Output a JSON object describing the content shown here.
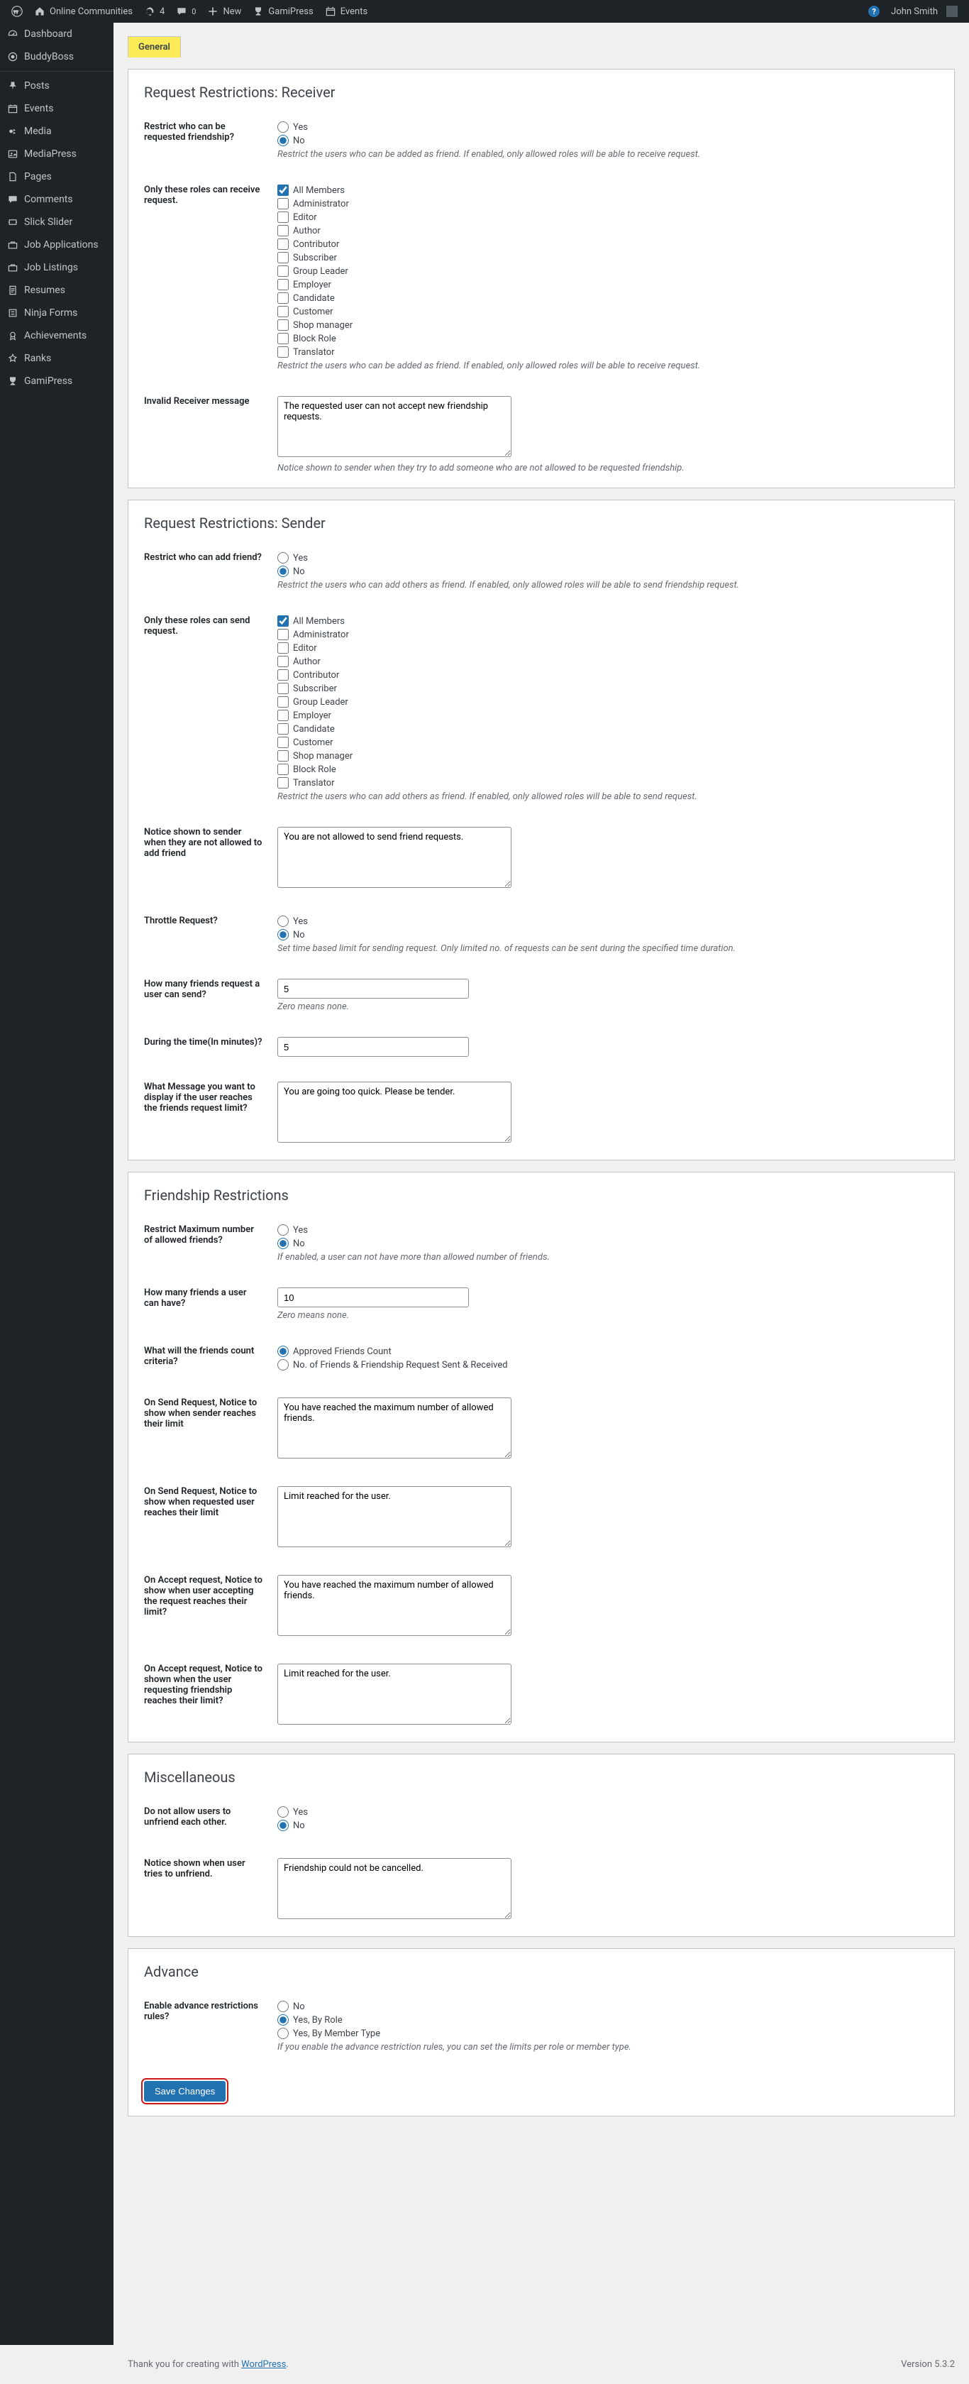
{
  "adminbar": {
    "site": "Online Communities",
    "updates": "4",
    "comments": "0",
    "new": "New",
    "gamipress": "GamiPress",
    "events": "Events",
    "user": "John Smith"
  },
  "sidebar": {
    "items": [
      {
        "label": "Dashboard",
        "icon": "dashboard"
      },
      {
        "label": "BuddyBoss",
        "icon": "buddyboss"
      },
      {
        "label": "Posts",
        "icon": "pin"
      },
      {
        "label": "Events",
        "icon": "calendar"
      },
      {
        "label": "Media",
        "icon": "media"
      },
      {
        "label": "MediaPress",
        "icon": "mediapress"
      },
      {
        "label": "Pages",
        "icon": "page"
      },
      {
        "label": "Comments",
        "icon": "comment"
      },
      {
        "label": "Slick Slider",
        "icon": "slider"
      },
      {
        "label": "Job Applications",
        "icon": "briefcase"
      },
      {
        "label": "Job Listings",
        "icon": "briefcase"
      },
      {
        "label": "Resumes",
        "icon": "resume"
      },
      {
        "label": "Ninja Forms",
        "icon": "forms"
      },
      {
        "label": "Achievements",
        "icon": "achieve"
      },
      {
        "label": "Ranks",
        "icon": "ranks"
      },
      {
        "label": "GamiPress",
        "icon": "gamipress"
      }
    ]
  },
  "tab": {
    "general": "General"
  },
  "s1": {
    "title": "Request Restrictions: Receiver",
    "q1": "Restrict who can be requested friendship?",
    "yes": "Yes",
    "no": "No",
    "q1desc": "Restrict the users who can be added as friend. If enabled, only allowed roles will be able to receive request.",
    "q2": "Only these roles can receive request.",
    "roles": [
      "All Members",
      "Administrator",
      "Editor",
      "Author",
      "Contributor",
      "Subscriber",
      "Group Leader",
      "Employer",
      "Candidate",
      "Customer",
      "Shop manager",
      "Block Role",
      "Translator"
    ],
    "q2desc": "Restrict the users who can be added as friend. If enabled, only allowed roles will be able to receive request.",
    "q3": "Invalid Receiver message",
    "q3val": "The requested user can not accept new friendship requests.",
    "q3desc": "Notice shown to sender when they try to add someone who are not allowed to be requested friendship."
  },
  "s2": {
    "title": "Request Restrictions: Sender",
    "q1": "Restrict who can add friend?",
    "q1desc": "Restrict the users who can add others as friend. If enabled, only allowed roles will be able to send friendship request.",
    "q2": "Only these roles can send request.",
    "roles": [
      "All Members",
      "Administrator",
      "Editor",
      "Author",
      "Contributor",
      "Subscriber",
      "Group Leader",
      "Employer",
      "Candidate",
      "Customer",
      "Shop manager",
      "Block Role",
      "Translator"
    ],
    "q2desc": "Restrict the users who can add others as friend. If enabled, only allowed roles will be able to send request.",
    "q3": "Notice shown to sender when they are not allowed to add friend",
    "q3val": "You are not allowed to send friend requests.",
    "q4": "Throttle Request?",
    "q4desc": "Set time based limit for sending request. Only limited no. of requests can be sent during the specified time duration.",
    "q5": "How many friends request a user can send?",
    "q5val": "5",
    "q5desc": "Zero means none.",
    "q6": "During the time(In minutes)?",
    "q6val": "5",
    "q7": "What Message you want to display if the user reaches the friends request limit?",
    "q7val": "You are going too quick. Please be tender."
  },
  "s3": {
    "title": "Friendship Restrictions",
    "q1": "Restrict Maximum number of allowed friends?",
    "q1desc": "If enabled, a user can not have more than allowed number of friends.",
    "q2": "How many friends a user can have?",
    "q2val": "10",
    "q2desc": "Zero means none.",
    "q3": "What will the friends count criteria?",
    "q3o1": "Approved Friends Count",
    "q3o2": "No. of Friends & Friendship Request Sent & Received",
    "q4": "On Send Request, Notice to show when sender reaches their limit",
    "q4val": "You have reached the maximum number of allowed friends.",
    "q5": "On Send Request, Notice to show when requested user reaches their limit",
    "q5val": "Limit reached for the user.",
    "q6": "On Accept request, Notice to show when user accepting the request reaches their limit?",
    "q6val": "You have reached the maximum number of allowed friends.",
    "q7": "On Accept request, Notice to shown when the user requesting friendship reaches their limit?",
    "q7val": "Limit reached for the user."
  },
  "s4": {
    "title": "Miscellaneous",
    "q1": "Do not allow users to unfriend each other.",
    "q2": "Notice shown when user tries to unfriend.",
    "q2val": "Friendship could not be cancelled."
  },
  "s5": {
    "title": "Advance",
    "q1": "Enable advance restrictions rules?",
    "o1": "No",
    "o2": "Yes, By Role",
    "o3": "Yes, By Member Type",
    "desc": "If you enable the advance restriction rules, you can set the limits per role or member type."
  },
  "submit": "Save Changes",
  "footer": {
    "thank": "Thank you for creating with ",
    "wp": "WordPress",
    "version": "Version 5.3.2"
  }
}
